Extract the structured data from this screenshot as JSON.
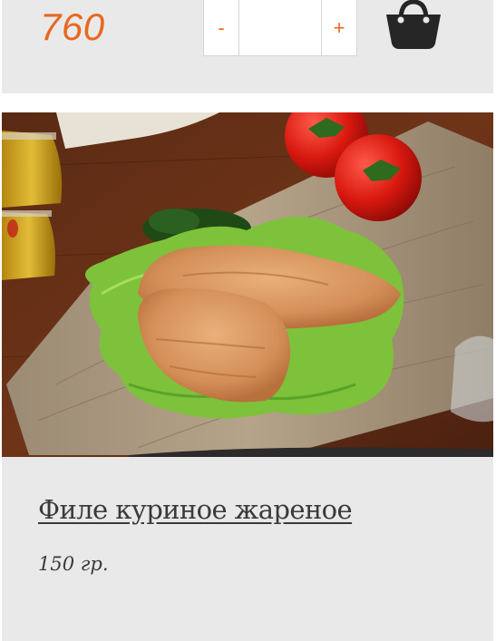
{
  "top_product": {
    "price": "760",
    "quantity": {
      "minus_label": "-",
      "value": "",
      "plus_label": "+"
    },
    "cart_icon": "shopping-bag-icon"
  },
  "product": {
    "image_subject": "grilled chicken fillet on lettuce on a wooden board with cherry tomatoes, herbs and oil bottles",
    "title": "Филе куриное жареное",
    "weight": "150 гр."
  },
  "colors": {
    "accent": "#e8691f",
    "card_bg": "#e9e9e9",
    "text": "#3a3a3a"
  }
}
